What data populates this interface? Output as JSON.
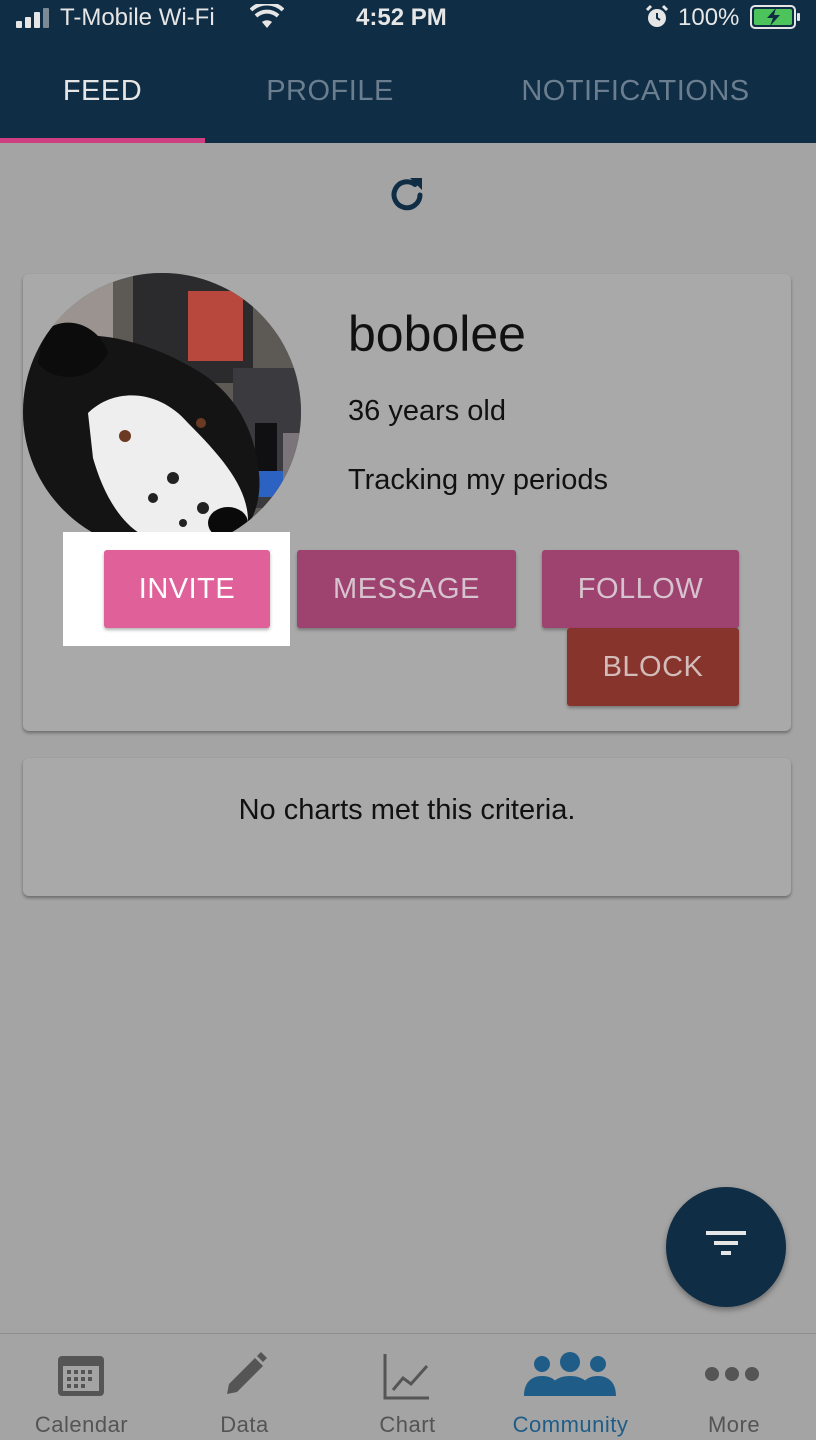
{
  "status_bar": {
    "carrier": "T-Mobile Wi-Fi",
    "time": "4:52 PM",
    "battery": "100%"
  },
  "tabs": [
    {
      "label": "FEED",
      "active": true
    },
    {
      "label": "PROFILE",
      "active": false
    },
    {
      "label": "NOTIFICATIONS",
      "active": false
    }
  ],
  "profile": {
    "username": "bobolee",
    "age": "36 years old",
    "tracking": "Tracking my periods",
    "buttons": {
      "invite": "INVITE",
      "message": "MESSAGE",
      "follow": "FOLLOW",
      "block": "BLOCK"
    }
  },
  "charts": {
    "empty_text": "No charts met this criteria."
  },
  "bottom_nav": [
    {
      "label": "Calendar",
      "icon": "calendar-icon",
      "active": false
    },
    {
      "label": "Data",
      "icon": "pencil-icon",
      "active": false
    },
    {
      "label": "Chart",
      "icon": "chart-icon",
      "active": false
    },
    {
      "label": "Community",
      "icon": "people-icon",
      "active": true
    },
    {
      "label": "More",
      "icon": "more-icon",
      "active": false
    }
  ],
  "colors": {
    "header": "#0f2d45",
    "accent": "#cf3e80",
    "invite": "#e0609a",
    "block": "#87342d",
    "active_nav": "#1f5d88"
  }
}
